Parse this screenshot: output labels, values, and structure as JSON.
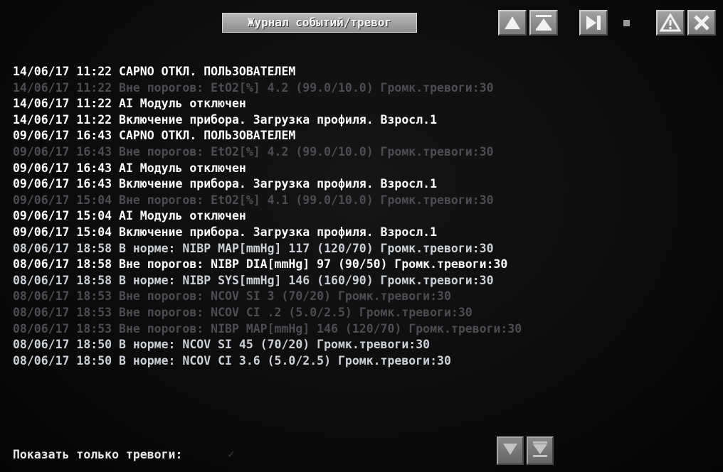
{
  "header": {
    "title": "Журнал событий/тревог"
  },
  "toolbar": {
    "icons": [
      "scroll-up-icon",
      "scroll-to-top-icon",
      "scroll-to-end-icon",
      "alarm-warning-icon",
      "close-icon"
    ]
  },
  "log": {
    "rows": [
      {
        "text": "14/06/17 11:22 CAPNO ОТКЛ. ПОЛЬЗОВАТЕЛЕМ",
        "tone": "hi"
      },
      {
        "text": "14/06/17 11:22 Вне порогов: EtO2[%] 4.2 (99.0/10.0) Громк.тревоги:30",
        "tone": "lo"
      },
      {
        "text": "14/06/17 11:22 AI Модуль отключен",
        "tone": "hi"
      },
      {
        "text": "14/06/17 11:22 Включение прибора. Загрузка профиля. Взросл.1",
        "tone": "hi"
      },
      {
        "text": "09/06/17 16:43 CAPNO ОТКЛ. ПОЛЬЗОВАТЕЛЕМ",
        "tone": "hi"
      },
      {
        "text": "09/06/17 16:43 Вне порогов: EtO2[%] 4.2 (99.0/10.0) Громк.тревоги:30",
        "tone": "lo"
      },
      {
        "text": "09/06/17 16:43 AI Модуль отключен",
        "tone": "hi"
      },
      {
        "text": "09/06/17 16:43 Включение прибора. Загрузка профиля. Взросл.1",
        "tone": "hi"
      },
      {
        "text": "09/06/17 15:04 Вне порогов: EtO2[%] 4.1 (99.0/10.0) Громк.тревоги:30",
        "tone": "lo"
      },
      {
        "text": "09/06/17 15:04 AI Модуль отключен",
        "tone": "hi"
      },
      {
        "text": "09/06/17 15:04 Включение прибора. Загрузка профиля. Взросл.1",
        "tone": "hi"
      },
      {
        "text": "08/06/17 18:58 В норме: NIBP MAP[mmHg] 117 (120/70) Громк.тревоги:30",
        "tone": "mid"
      },
      {
        "text": "08/06/17 18:58 Вне порогов: NIBP DIA[mmHg] 97 (90/50) Громк.тревоги:30",
        "tone": "hi"
      },
      {
        "text": "08/06/17 18:58 В норме: NIBP SYS[mmHg] 146 (160/90) Громк.тревоги:30",
        "tone": "mid"
      },
      {
        "text": "08/06/17 18:53 Вне порогов: NCOV SI 3 (70/20) Громк.тревоги:30",
        "tone": "lo"
      },
      {
        "text": "08/06/17 18:53 Вне порогов: NCOV CI .2 (5.0/2.5) Громк.тревоги:30",
        "tone": "lo"
      },
      {
        "text": "08/06/17 18:53 Вне порогов: NIBP MAP[mmHg] 146 (120/70) Громк.тревоги:30",
        "tone": "lo"
      },
      {
        "text": "08/06/17 18:50 В норме: NCOV SI 45 (70/20) Громк.тревоги:30",
        "tone": "mid"
      },
      {
        "text": "08/06/17 18:50 В норме: NCOV CI 3.6 (5.0/2.5) Громк.тревоги:30",
        "tone": "mid"
      }
    ]
  },
  "footer": {
    "filter_label": "Показать только тревоги:",
    "filter_checked": false
  }
}
